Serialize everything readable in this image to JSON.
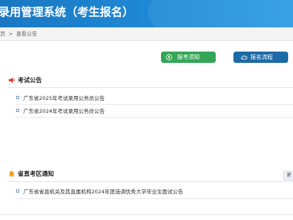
{
  "header": {
    "title": "录用管理系统（考生报名）"
  },
  "breadcrumb": {
    "home": "页",
    "sep": ">",
    "current": "查看公告"
  },
  "buttons": {
    "notice_label": "报考须知",
    "flow_label": "报名流程",
    "notice_color": "#35a558",
    "flow_color": "#1c6aa6"
  },
  "sections": {
    "exam": {
      "title": "考试公告",
      "icon": "megaphone-icon",
      "items": [
        "广东省2025年考试录用公务员公告",
        "广东省2024年考试录用公务员公告"
      ]
    },
    "region": {
      "title": "省直考区通知",
      "icon": "bell-icon",
      "items": [
        "广东省省直机关及其直属机构2024年度选调优秀大学毕业生面试公告"
      ],
      "more_label": "更"
    }
  }
}
